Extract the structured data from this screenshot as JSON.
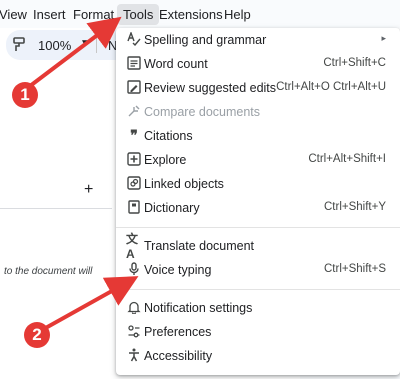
{
  "menubar": {
    "items": [
      "View",
      "Insert",
      "Format",
      "Tools",
      "Extensions",
      "Help"
    ],
    "active": "Tools"
  },
  "toolbar": {
    "paint_format_icon": "paint-format-icon",
    "zoom": "100%",
    "style_partial": "No"
  },
  "document": {
    "add_tab_icon": "+",
    "text_fragment": "to the document will"
  },
  "tools_menu": {
    "items": [
      {
        "label": "Spelling and grammar",
        "shortcut": "",
        "icon": "spellcheck-icon",
        "submenu": "▸",
        "disabled": false
      },
      {
        "label": "Word count",
        "shortcut": "Ctrl+Shift+C",
        "icon": "word-count-icon",
        "disabled": false
      },
      {
        "label": "Review suggested edits",
        "shortcut": "Ctrl+Alt+O Ctrl+Alt+U",
        "icon": "review-edits-icon",
        "disabled": false
      },
      {
        "label": "Compare documents",
        "shortcut": "",
        "icon": "compare-icon",
        "disabled": true
      },
      {
        "label": "Citations",
        "shortcut": "",
        "icon": "quote-icon",
        "disabled": false
      },
      {
        "label": "Explore",
        "shortcut": "Ctrl+Alt+Shift+I",
        "icon": "explore-icon",
        "disabled": false
      },
      {
        "label": "Linked objects",
        "shortcut": "",
        "icon": "linked-objects-icon",
        "disabled": false
      },
      {
        "label": "Dictionary",
        "shortcut": "Ctrl+Shift+Y",
        "icon": "dictionary-icon",
        "disabled": false
      },
      {
        "label": "Translate document",
        "shortcut": "",
        "icon": "translate-icon",
        "disabled": false
      },
      {
        "label": "Voice typing",
        "shortcut": "Ctrl+Shift+S",
        "icon": "microphone-icon",
        "disabled": false
      },
      {
        "label": "Notification settings",
        "shortcut": "",
        "icon": "bell-icon",
        "disabled": false
      },
      {
        "label": "Preferences",
        "shortcut": "",
        "icon": "preferences-icon",
        "disabled": false
      },
      {
        "label": "Accessibility",
        "shortcut": "",
        "icon": "accessibility-icon",
        "disabled": false
      }
    ]
  },
  "annotations": {
    "step1": "1",
    "step2": "2",
    "color": "#e53935"
  }
}
